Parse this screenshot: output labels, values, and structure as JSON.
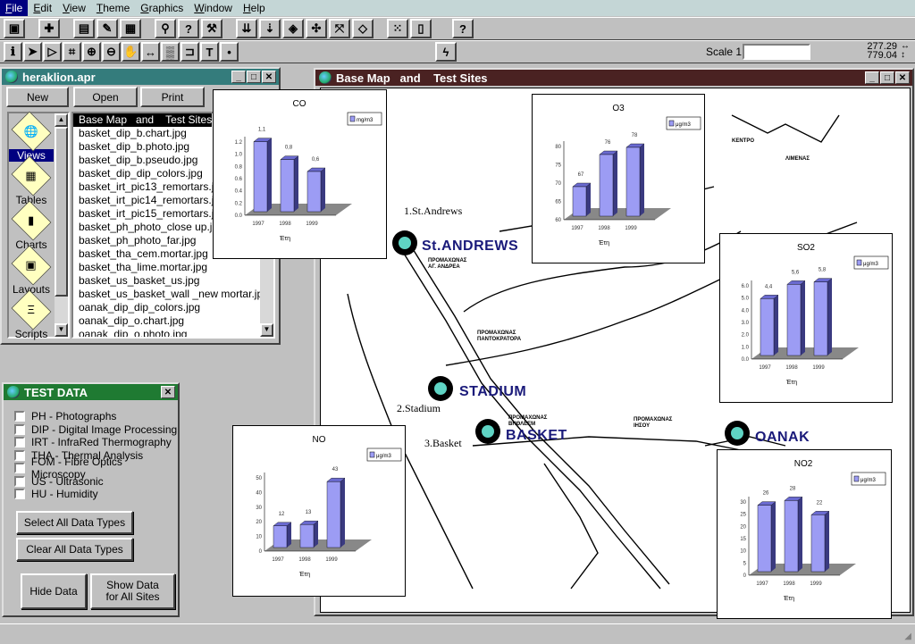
{
  "menubar": {
    "items": [
      "File",
      "Edit",
      "View",
      "Theme",
      "Graphics",
      "Window",
      "Help"
    ]
  },
  "toolbar1": [
    {
      "icon": "save-icon",
      "g": "▣"
    },
    {
      "icon": "add-theme-icon",
      "g": "✚"
    },
    {
      "icon": "theme-properties-icon",
      "g": "▤"
    },
    {
      "icon": "edit-legend-icon",
      "g": "✎"
    },
    {
      "icon": "open-table-icon",
      "g": "▦"
    },
    {
      "icon": "find-icon",
      "g": "⚲"
    },
    {
      "icon": "query-builder-icon",
      "g": "?"
    },
    {
      "icon": "locate-address-icon",
      "g": "⚒"
    },
    {
      "icon": "zoom-full-extent-icon",
      "g": "⇊"
    },
    {
      "icon": "zoom-active-themes-icon",
      "g": "⇣"
    },
    {
      "icon": "zoom-selected-icon",
      "g": "◈"
    },
    {
      "icon": "zoom-in-fixed-icon",
      "g": "✣"
    },
    {
      "icon": "zoom-out-fixed-icon",
      "g": "⤧"
    },
    {
      "icon": "zoom-previous-icon",
      "g": "◇"
    },
    {
      "icon": "select-none-icon",
      "g": "⁙"
    },
    {
      "icon": "layout-icon",
      "g": "▯"
    },
    {
      "icon": "help-icon",
      "g": "?"
    }
  ],
  "toolbar2": [
    {
      "icon": "identify-icon",
      "g": "ℹ"
    },
    {
      "icon": "pointer-icon",
      "g": "➤"
    },
    {
      "icon": "vertex-edit-icon",
      "g": "▷"
    },
    {
      "icon": "select-feature-icon",
      "g": "⌗"
    },
    {
      "icon": "zoom-in-icon",
      "g": "⊕"
    },
    {
      "icon": "zoom-out-icon",
      "g": "⊖"
    },
    {
      "icon": "pan-icon",
      "g": "✋"
    },
    {
      "icon": "measure-icon",
      "g": "↔"
    },
    {
      "icon": "label-icon",
      "g": "▒"
    },
    {
      "icon": "text-label-icon",
      "g": "⊐"
    },
    {
      "icon": "text-icon",
      "g": "T"
    },
    {
      "icon": "draw-point-icon",
      "g": "•"
    }
  ],
  "hotlink": {
    "icon": "hotlink-icon",
    "g": "ϟ"
  },
  "scale": {
    "label": "Scale 1:",
    "value": ""
  },
  "coords": {
    "x": "277.29",
    "y": "779.04"
  },
  "project": {
    "title": "heraklion.apr",
    "buttons": [
      "New",
      "Open",
      "Print"
    ],
    "doc_types": [
      {
        "label": "Views",
        "icon": "views-icon",
        "g": "🌐"
      },
      {
        "label": "Tables",
        "icon": "tables-icon",
        "g": "▦"
      },
      {
        "label": "Charts",
        "icon": "charts-icon",
        "g": "▮"
      },
      {
        "label": "Layouts",
        "icon": "layouts-icon",
        "g": "▣"
      },
      {
        "label": "Scripts",
        "icon": "scripts-icon",
        "g": "Ξ"
      }
    ],
    "selected_type": "Views",
    "items": [
      "Base Map   and    Test Sites",
      "basket_dip_b.chart.jpg",
      "basket_dip_b.photo.jpg",
      "basket_dip_b.pseudo.jpg",
      "basket_dip_dip_colors.jpg",
      "basket_irt_pic13_remortars.jpg",
      "basket_irt_pic14_remortars.jpg",
      "basket_irt_pic15_remortars.jpg",
      "basket_ph_photo_close up.jpg",
      "basket_ph_photo_far.jpg",
      "basket_tha_cem.mortar.jpg",
      "basket_tha_lime.mortar.jpg",
      "basket_us_basket_us.jpg",
      "basket_us_basket_wall _new mortar.jpg",
      "oanak_dip_dip_colors.jpg",
      "oanak_dip_o.chart.jpg",
      "oanak_dip_o.photo.jpg"
    ]
  },
  "test_data": {
    "title": "TEST DATA",
    "options": [
      "PH - Photographs",
      "DIP - Digital Image Processing",
      "IRT - InfraRed Thermography",
      "THA - Thermal Analysis",
      "FOM - Fibre Optics Microscopy",
      "US - Ultrasonic",
      "HU - Humidity"
    ],
    "select_all": "Select All Data Types",
    "clear_all": "Clear All Data Types",
    "hide": "Hide Data",
    "show_all": "Show Data for All Sites"
  },
  "view": {
    "title": "Base Map   and    Test Sites",
    "sites": [
      {
        "name": "St.ANDREWS",
        "note": "1.St.Andrews"
      },
      {
        "name": "STADIUM",
        "note": "2.Stadium"
      },
      {
        "name": "BASKET",
        "note": "3.Basket"
      },
      {
        "name": "OANAK",
        "note": ""
      }
    ],
    "marker_color": "#5fd4c4",
    "label_color": "#1a1a7a"
  },
  "chart_data": [
    {
      "type": "bar",
      "title": "CO",
      "legend": "mg/m3",
      "categories": [
        "1997",
        "1998",
        "1999"
      ],
      "values": [
        1.1,
        0.8,
        0.6
      ],
      "value_labels": [
        "1,1",
        "0,8",
        "0,6"
      ],
      "ylim": [
        0,
        1.2
      ],
      "yticks": [
        "0.0",
        "0.2",
        "0.4",
        "0.6",
        "0.8",
        "1.0",
        "1.2"
      ],
      "xlabel": "Έτη",
      "bar_color": "#9c9cf4"
    },
    {
      "type": "bar",
      "title": "O3",
      "legend": "μg/m3",
      "categories": [
        "1997",
        "1998",
        "1999"
      ],
      "values": [
        67,
        76,
        78
      ],
      "value_labels": [
        "67",
        "76",
        "78"
      ],
      "ylim": [
        60,
        80
      ],
      "yticks": [
        "60",
        "65",
        "70",
        "75",
        "80"
      ],
      "xlabel": "Έτη",
      "bar_color": "#9c9cf4"
    },
    {
      "type": "bar",
      "title": "SO2",
      "legend": "μg/m3",
      "categories": [
        "1997",
        "1998",
        "1999"
      ],
      "values": [
        4.4,
        5.6,
        5.8
      ],
      "value_labels": [
        "4,4",
        "5,6",
        "5,8"
      ],
      "ylim": [
        0,
        6
      ],
      "yticks": [
        "0.0",
        "1.0",
        "2.0",
        "3.0",
        "4.0",
        "5.0",
        "6.0"
      ],
      "xlabel": "Έτη",
      "bar_color": "#9c9cf4"
    },
    {
      "type": "bar",
      "title": "NO",
      "legend": "μg/m3",
      "categories": [
        "1997",
        "1998",
        "1999"
      ],
      "values": [
        12,
        13,
        43
      ],
      "value_labels": [
        "12",
        "13",
        "43"
      ],
      "ylim": [
        0,
        50
      ],
      "yticks": [
        "0",
        "10",
        "20",
        "30",
        "40",
        "50"
      ],
      "xlabel": "Έτη",
      "bar_color": "#9c9cf4"
    },
    {
      "type": "bar",
      "title": "NO2",
      "legend": "μg/m3",
      "categories": [
        "1997",
        "1998",
        "1999"
      ],
      "values": [
        26,
        28,
        22
      ],
      "value_labels": [
        "26",
        "28",
        "22"
      ],
      "ylim": [
        0,
        30
      ],
      "yticks": [
        "0",
        "5",
        "10",
        "15",
        "20",
        "25",
        "30"
      ],
      "xlabel": "Έτη",
      "bar_color": "#9c9cf4"
    }
  ]
}
